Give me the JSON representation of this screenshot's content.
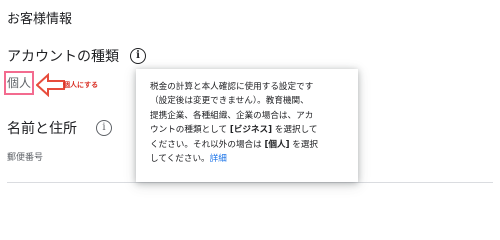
{
  "section": {
    "title": "お客様情報"
  },
  "account_type": {
    "label": "アカウントの種類",
    "value": "個人",
    "info_icon": "info-icon"
  },
  "annotation": {
    "text": "個人にする",
    "color": "#d93025",
    "arrow_color": "#e74c3c",
    "highlight_color": "#f36b8f"
  },
  "name_address": {
    "label": "名前と住所",
    "info_icon": "info-icon"
  },
  "postal_code": {
    "label": "郵便番号"
  },
  "tooltip": {
    "line1": "税金の計算と本人確認に使用する設定です",
    "line2": "（設定後は変更できません）。教育機関、",
    "line3": "提携企業、各種組織、企業の場合は、アカ",
    "line4_pre": "ウントの種類として ",
    "line4_bold": "[ビジネス]",
    "line4_post": " を選択して",
    "line5": "ください。それ以外の場合は ",
    "line5_bold": "[個人]",
    "line5_post": " を選択",
    "line6_pre": "してください。",
    "learn_more": "詳細",
    "link_color": "#1a73e8"
  }
}
